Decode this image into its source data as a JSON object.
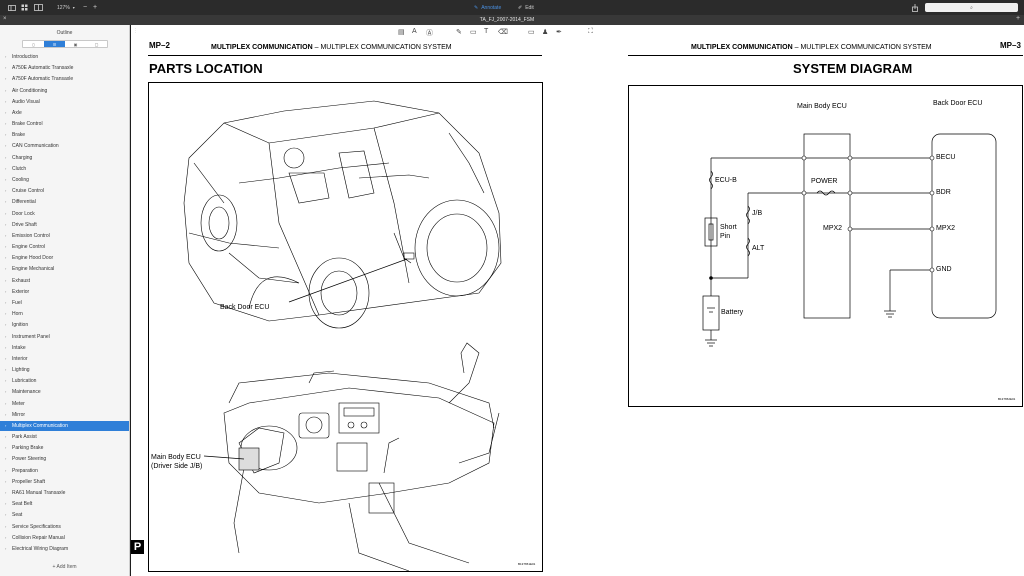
{
  "toolbar": {
    "zoom": "127%",
    "annotate": "Annotate",
    "edit": "Edit"
  },
  "window": {
    "title": "TA_FJ_2007-2014_FSM"
  },
  "sidebar": {
    "title": "Outline",
    "add_item": "Add Item",
    "selected_index": 33,
    "items": [
      "Introduction",
      "A750E Automatic Transaxle",
      "A750F Automatic Transaxle",
      "Air Conditioning",
      "Audio Visual",
      "Axle",
      "Brake Control",
      "Brake",
      "CAN Communication",
      "Charging",
      "Clutch",
      "Cooling",
      "Cruise Control",
      "Differential",
      "Door Lock",
      "Drive Shaft",
      "Emission Control",
      "Engine Control",
      "Engine Hood Door",
      "Engine Mechanical",
      "Exhaust",
      "Exterior",
      "Fuel",
      "Horn",
      "Ignition",
      "Instrument Panel",
      "Intake",
      "Interior",
      "Lighting",
      "Lubrication",
      "Maintenance",
      "Meter",
      "Mirror",
      "Multiplex Communication",
      "Park Assist",
      "Parking Brake",
      "Power Steering",
      "Preparation",
      "Propeller Shaft",
      "RA61 Manual Transaxle",
      "Seat Belt",
      "Seat",
      "Service Specifications",
      "Collision Repair Manual",
      "Electrical Wiring Diagram"
    ]
  },
  "left_page": {
    "page_code": "MP–2",
    "header_bold": "MULTIPLEX COMMUNICATION",
    "header_dash": "–",
    "header_rest": "MULTIPLEX COMMUNICATION SYSTEM",
    "title": "PARTS LOCATION",
    "label_back_door": "Back Door ECU",
    "label_main_body_1": "Main Body ECU",
    "label_main_body_2": "(Driver Side J/B)",
    "figure_code": "B137651E01",
    "tab_letter": "P"
  },
  "right_page": {
    "page_code": "MP–3",
    "header_bold": "MULTIPLEX COMMUNICATION",
    "header_dash": "–",
    "header_rest": "MULTIPLEX COMMUNICATION SYSTEM",
    "title": "SYSTEM DIAGRAM",
    "figure_code": "B137652E01",
    "diagram": {
      "main_body_ecu": "Main Body ECU",
      "back_door_ecu": "Back Door ECU",
      "ecu_b": "ECU-B",
      "power": "POWER",
      "jb": "J/B",
      "alt": "ALT",
      "short_pin_1": "Short",
      "short_pin_2": "Pin",
      "battery": "Battery",
      "mpx2_left": "MPX2",
      "becu": "BECU",
      "bdr": "BDR",
      "mpx2_right": "MPX2",
      "gnd": "GND"
    }
  }
}
